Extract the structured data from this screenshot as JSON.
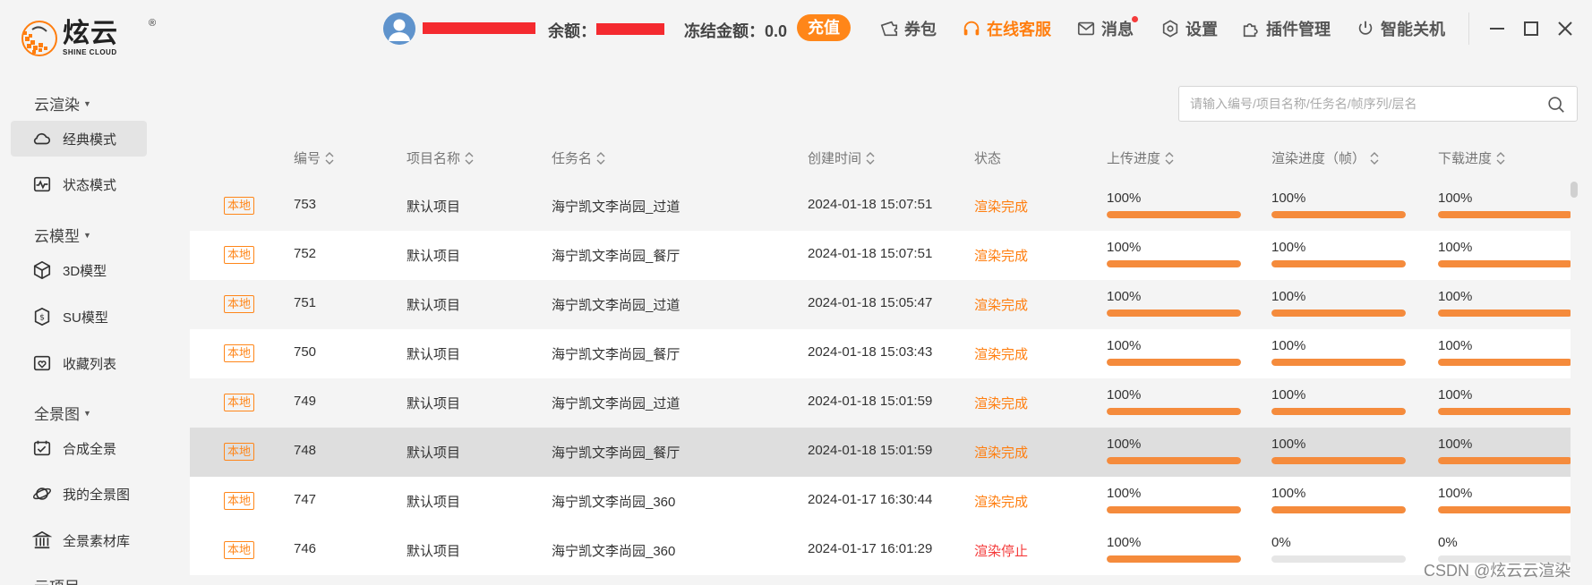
{
  "logo": {
    "cn": "炫云",
    "en": "SHINE CLOUD",
    "reg": "®"
  },
  "sidebar": {
    "sections": [
      {
        "label": "云渲染"
      },
      {
        "label": "云模型"
      },
      {
        "label": "全景图"
      },
      {
        "label": "云项目"
      }
    ],
    "items": [
      {
        "label": "经典模式",
        "icon": "cloud-icon"
      },
      {
        "label": "状态模式",
        "icon": "pulse-icon"
      },
      {
        "label": "3D模型",
        "icon": "cube-icon"
      },
      {
        "label": "SU模型",
        "icon": "shield-s-icon"
      },
      {
        "label": "收藏列表",
        "icon": "heart-folder-icon"
      },
      {
        "label": "合成全景",
        "icon": "panorama-compose-icon"
      },
      {
        "label": "我的全景图",
        "icon": "planet-icon"
      },
      {
        "label": "全景素材库",
        "icon": "library-icon"
      }
    ]
  },
  "header": {
    "balance_label": "余额：",
    "frozen_label": "冻结金额：0.0",
    "recharge": "充值",
    "actions": [
      {
        "label": "券包",
        "icon": "ticket-icon"
      },
      {
        "label": "在线客服",
        "icon": "headset-icon"
      },
      {
        "label": "消息",
        "icon": "mail-icon"
      },
      {
        "label": "设置",
        "icon": "gear-icon"
      },
      {
        "label": "插件管理",
        "icon": "plugin-icon"
      },
      {
        "label": "智能关机",
        "icon": "power-icon"
      }
    ],
    "accent": "#ff7e0f"
  },
  "search": {
    "placeholder": "请输入编号/项目名称/任务名/帧序列/层名"
  },
  "table": {
    "columns": [
      "编号",
      "项目名称",
      "任务名",
      "创建时间",
      "状态",
      "上传进度",
      "渲染进度（帧）",
      "下载进度"
    ],
    "rows": [
      {
        "badge": "本地",
        "id": "753",
        "project": "默认项目",
        "task": "海宁凯文李尚园_过道",
        "created": "2024-01-18 15:07:51",
        "status": "渲染完成",
        "upload": "100%",
        "upload_v": 100,
        "render": "100%",
        "render_v": 100,
        "download": "100%",
        "download_v": 100
      },
      {
        "badge": "本地",
        "id": "752",
        "project": "默认项目",
        "task": "海宁凯文李尚园_餐厅",
        "created": "2024-01-18 15:07:51",
        "status": "渲染完成",
        "upload": "100%",
        "upload_v": 100,
        "render": "100%",
        "render_v": 100,
        "download": "100%",
        "download_v": 100
      },
      {
        "badge": "本地",
        "id": "751",
        "project": "默认项目",
        "task": "海宁凯文李尚园_过道",
        "created": "2024-01-18 15:05:47",
        "status": "渲染完成",
        "upload": "100%",
        "upload_v": 100,
        "render": "100%",
        "render_v": 100,
        "download": "100%",
        "download_v": 100
      },
      {
        "badge": "本地",
        "id": "750",
        "project": "默认项目",
        "task": "海宁凯文李尚园_餐厅",
        "created": "2024-01-18 15:03:43",
        "status": "渲染完成",
        "upload": "100%",
        "upload_v": 100,
        "render": "100%",
        "render_v": 100,
        "download": "100%",
        "download_v": 100
      },
      {
        "badge": "本地",
        "id": "749",
        "project": "默认项目",
        "task": "海宁凯文李尚园_过道",
        "created": "2024-01-18 15:01:59",
        "status": "渲染完成",
        "upload": "100%",
        "upload_v": 100,
        "render": "100%",
        "render_v": 100,
        "download": "100%",
        "download_v": 100
      },
      {
        "badge": "本地",
        "id": "748",
        "project": "默认项目",
        "task": "海宁凯文李尚园_餐厅",
        "created": "2024-01-18 15:01:59",
        "status": "渲染完成",
        "upload": "100%",
        "upload_v": 100,
        "render": "100%",
        "render_v": 100,
        "download": "100%",
        "download_v": 100
      },
      {
        "badge": "本地",
        "id": "747",
        "project": "默认项目",
        "task": "海宁凯文李尚园_360",
        "created": "2024-01-17 16:30:44",
        "status": "渲染完成",
        "upload": "100%",
        "upload_v": 100,
        "render": "100%",
        "render_v": 100,
        "download": "100%",
        "download_v": 100
      },
      {
        "badge": "本地",
        "id": "746",
        "project": "默认项目",
        "task": "海宁凯文李尚园_360",
        "created": "2024-01-17 16:01:29",
        "status": "渲染停止",
        "upload": "100%",
        "upload_v": 100,
        "render": "0%",
        "render_v": 0,
        "download": "0%",
        "download_v": 0
      }
    ]
  },
  "colors": {
    "progress": "#f58b3c",
    "status_done": "#ff7e0f",
    "status_stop": "#f43b3b"
  },
  "watermark": "CSDN @炫云云渲染"
}
